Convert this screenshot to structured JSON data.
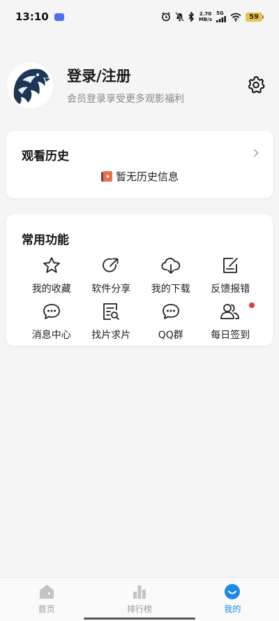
{
  "status_bar": {
    "time": "13:10",
    "net_speed_value": "2.70",
    "net_speed_unit": "MB/s",
    "network_type": "5G",
    "battery_level": "59"
  },
  "profile": {
    "title": "登录/注册",
    "subtitle": "会员登录享受更多观影福利"
  },
  "history": {
    "title": "观看历史",
    "empty_text": "暂无历史信息"
  },
  "functions": {
    "title": "常用功能",
    "items": [
      {
        "label": "我的收藏",
        "icon": "star-icon"
      },
      {
        "label": "软件分享",
        "icon": "share-icon"
      },
      {
        "label": "我的下载",
        "icon": "cloud-download-icon"
      },
      {
        "label": "反馈报错",
        "icon": "feedback-edit-icon"
      },
      {
        "label": "消息中心",
        "icon": "chat-bubble-icon"
      },
      {
        "label": "找片求片",
        "icon": "document-search-icon"
      },
      {
        "label": "QQ群",
        "icon": "group-chat-icon"
      },
      {
        "label": "每日签到",
        "icon": "users-icon"
      }
    ]
  },
  "bottom_nav": {
    "items": [
      {
        "label": "首页",
        "icon": "home-icon",
        "active": false
      },
      {
        "label": "排行榜",
        "icon": "bar-chart-icon",
        "active": false
      },
      {
        "label": "我的",
        "icon": "smile-face-icon",
        "active": true
      }
    ]
  },
  "colors": {
    "accent": "#1e88e5",
    "background": "#f5f5f5",
    "badge_red": "#e53935",
    "battery": "#e8c34a"
  }
}
